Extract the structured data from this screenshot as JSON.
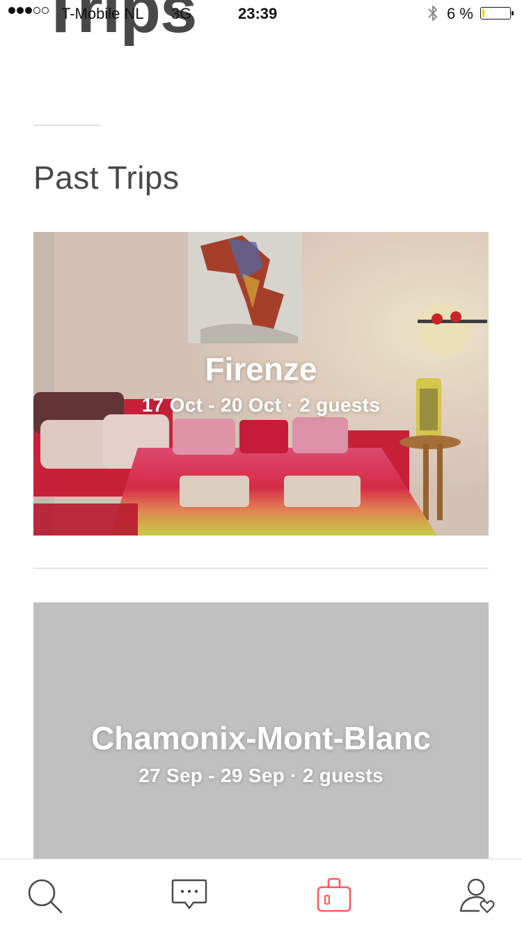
{
  "status_bar": {
    "carrier": "T-Mobile NL",
    "network": "3G",
    "time": "23:39",
    "battery_percent": "6 %",
    "battery_level": 0.06,
    "signal_bars": 3,
    "icons": [
      "bluetooth-icon",
      "battery-icon"
    ]
  },
  "header": {
    "title": "Trips"
  },
  "past_trips": {
    "title": "Past Trips",
    "items": [
      {
        "name": "Firenze",
        "meta": "17 Oct - 20 Oct · 2 guests"
      },
      {
        "name": "Chamonix-Mont-Blanc",
        "meta": "27 Sep - 29 Sep · 2 guests",
        "background": "#c0c0c0"
      }
    ]
  },
  "tab_bar": {
    "tabs": [
      {
        "name": "search",
        "icon": "search-icon",
        "active": false
      },
      {
        "name": "messages",
        "icon": "chat-bubble-icon",
        "active": false
      },
      {
        "name": "trips",
        "icon": "suitcase-icon",
        "active": true
      },
      {
        "name": "profile",
        "icon": "profile-heart-icon",
        "active": false
      }
    ],
    "active_color": "#ff5a5f",
    "inactive_color": "#484848"
  }
}
